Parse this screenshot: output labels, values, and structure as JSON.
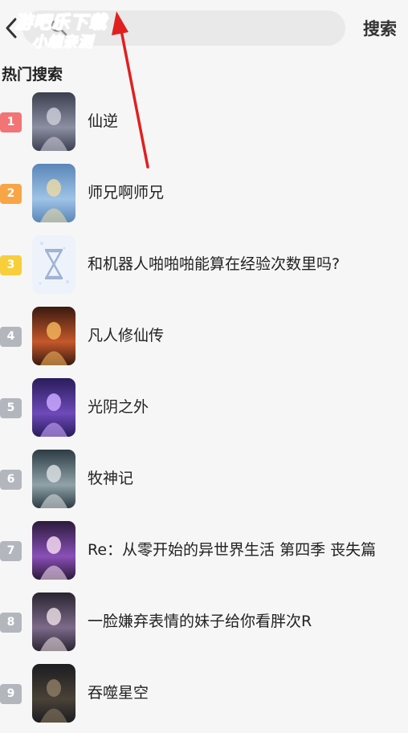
{
  "header": {
    "search_placeholder": "",
    "search_button": "搜索"
  },
  "watermark": {
    "line1": "游吧乐下载",
    "line2": "小编亲测"
  },
  "section": {
    "title": "热门搜索"
  },
  "hot_list": [
    {
      "rank": "1",
      "title": "仙逆",
      "rank_color": "#f27474"
    },
    {
      "rank": "2",
      "title": "师兄啊师兄",
      "rank_color": "#f7a546"
    },
    {
      "rank": "3",
      "title": "和机器人啪啪啪能算在经验次数里吗?",
      "rank_color": "#f8cf3a"
    },
    {
      "rank": "4",
      "title": "凡人修仙传",
      "rank_color": "#b3b7bd"
    },
    {
      "rank": "5",
      "title": "光阴之外",
      "rank_color": "#b3b7bd"
    },
    {
      "rank": "6",
      "title": "牧神记",
      "rank_color": "#b3b7bd"
    },
    {
      "rank": "7",
      "title": "Re：从零开始的异世界生活 第四季 丧失篇",
      "rank_color": "#b3b7bd"
    },
    {
      "rank": "8",
      "title": "一脸嫌弃表情的妹子给你看胖次R",
      "rank_color": "#b3b7bd"
    },
    {
      "rank": "9",
      "title": "吞噬星空",
      "rank_color": "#b3b7bd"
    }
  ],
  "colors": {
    "background": "#f6f6f6",
    "annotation_arrow": "#e02020",
    "watermark": "#2ec4ee"
  },
  "icons": {
    "back": "chevron-left-icon",
    "search": "search-icon"
  }
}
